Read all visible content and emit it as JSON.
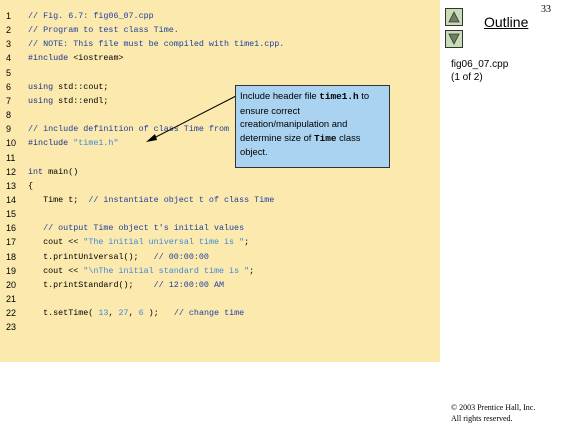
{
  "slide": {
    "page_number": "33",
    "outline_label": "Outline",
    "file_name": "fig06_07.cpp",
    "file_part": "(1 of 2)",
    "copyright_line1": "© 2003 Prentice Hall, Inc.",
    "copyright_line2": "All rights reserved."
  },
  "nav": {
    "up_icon": "triangle-up-icon",
    "down_icon": "triangle-down-icon"
  },
  "callout": {
    "text_part1": "Include header file ",
    "code1": "time1.h",
    "text_part2": " to ensure correct creation/manipulation and determine size of ",
    "code2": "Time",
    "text_part3": " class object."
  },
  "code_lines": [
    {
      "num": "1",
      "segs": [
        {
          "t": "// Fig. 6.7: fig06_07.cpp",
          "c": "comment"
        }
      ]
    },
    {
      "num": "2",
      "segs": [
        {
          "t": "// Program to test class Time.",
          "c": "comment"
        }
      ]
    },
    {
      "num": "3",
      "segs": [
        {
          "t": "// NOTE: This file must be compiled with time1.cpp.",
          "c": "comment"
        }
      ]
    },
    {
      "num": "4",
      "segs": [
        {
          "t": "#include",
          "c": "kw"
        },
        {
          "t": " <iostream>",
          "c": ""
        }
      ]
    },
    {
      "num": "5",
      "segs": []
    },
    {
      "num": "6",
      "segs": [
        {
          "t": "using",
          "c": "kw"
        },
        {
          "t": " std::cout;",
          "c": ""
        }
      ]
    },
    {
      "num": "7",
      "segs": [
        {
          "t": "using",
          "c": "kw"
        },
        {
          "t": " std::endl;",
          "c": ""
        }
      ]
    },
    {
      "num": "8",
      "segs": []
    },
    {
      "num": "9",
      "segs": [
        {
          "t": "// include definition of class Time from time1.h",
          "c": "comment"
        }
      ]
    },
    {
      "num": "10",
      "segs": [
        {
          "t": "#include",
          "c": "kw"
        },
        {
          "t": " ",
          "c": ""
        },
        {
          "t": "\"time1.h\"",
          "c": "string"
        }
      ]
    },
    {
      "num": "11",
      "segs": []
    },
    {
      "num": "12",
      "segs": [
        {
          "t": "int",
          "c": "kw"
        },
        {
          "t": " main()",
          "c": ""
        }
      ]
    },
    {
      "num": "13",
      "segs": [
        {
          "t": "{",
          "c": ""
        }
      ]
    },
    {
      "num": "14",
      "segs": [
        {
          "t": "   Time t;  ",
          "c": ""
        },
        {
          "t": "// instantiate object t of class Time",
          "c": "comment"
        }
      ]
    },
    {
      "num": "15",
      "segs": []
    },
    {
      "num": "16",
      "segs": [
        {
          "t": "   // output Time object t's initial values",
          "c": "comment"
        }
      ]
    },
    {
      "num": "17",
      "segs": [
        {
          "t": "   cout << ",
          "c": ""
        },
        {
          "t": "\"The initial universal time is \"",
          "c": "string"
        },
        {
          "t": ";",
          "c": ""
        }
      ]
    },
    {
      "num": "18",
      "segs": [
        {
          "t": "   t.printUniversal();   ",
          "c": ""
        },
        {
          "t": "// 00:00:00",
          "c": "comment"
        }
      ]
    },
    {
      "num": "19",
      "segs": [
        {
          "t": "   cout << ",
          "c": ""
        },
        {
          "t": "\"\\nThe initial standard time is \"",
          "c": "string"
        },
        {
          "t": ";",
          "c": ""
        }
      ]
    },
    {
      "num": "20",
      "segs": [
        {
          "t": "   t.printStandard();    ",
          "c": ""
        },
        {
          "t": "// 12:00:00 AM",
          "c": "comment"
        }
      ]
    },
    {
      "num": "21",
      "segs": []
    },
    {
      "num": "22",
      "segs": [
        {
          "t": "   t.setTime( ",
          "c": ""
        },
        {
          "t": "13",
          "c": "num"
        },
        {
          "t": ", ",
          "c": ""
        },
        {
          "t": "27",
          "c": "num"
        },
        {
          "t": ", ",
          "c": ""
        },
        {
          "t": "6",
          "c": "num"
        },
        {
          "t": " );   ",
          "c": ""
        },
        {
          "t": "// change time",
          "c": "comment"
        }
      ]
    },
    {
      "num": "23",
      "segs": []
    }
  ]
}
